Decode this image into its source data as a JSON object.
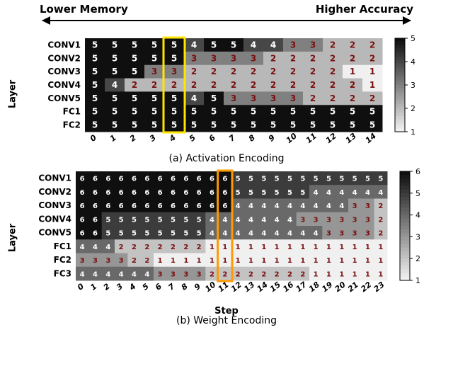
{
  "top_labels": {
    "left": "Lower Memory",
    "right": "Higher Accuracy"
  },
  "ylabel": "Layer",
  "xlabel": "Step",
  "caption_a": "(a) Activation Encoding",
  "caption_b": "(b) Weight Encoding",
  "chart_data": [
    {
      "id": "a",
      "type": "heatmap",
      "title": "Activation Encoding",
      "x": [
        0,
        1,
        2,
        3,
        4,
        5,
        6,
        7,
        8,
        9,
        10,
        11,
        12,
        13,
        14
      ],
      "y": [
        "CONV1",
        "CONV2",
        "CONV3",
        "CONV4",
        "CONV5",
        "FC1",
        "FC2"
      ],
      "values": [
        [
          5,
          5,
          5,
          5,
          5,
          4,
          5,
          5,
          4,
          4,
          3,
          3,
          2,
          2,
          2
        ],
        [
          5,
          5,
          5,
          5,
          5,
          3,
          3,
          3,
          3,
          2,
          2,
          2,
          2,
          2,
          2
        ],
        [
          5,
          5,
          5,
          3,
          3,
          2,
          2,
          2,
          2,
          2,
          2,
          2,
          2,
          1,
          1
        ],
        [
          5,
          4,
          2,
          2,
          2,
          2,
          2,
          2,
          2,
          2,
          2,
          2,
          2,
          2,
          1
        ],
        [
          5,
          5,
          5,
          5,
          5,
          4,
          5,
          3,
          3,
          3,
          3,
          2,
          2,
          2,
          2
        ],
        [
          5,
          5,
          5,
          5,
          5,
          5,
          5,
          5,
          5,
          5,
          5,
          5,
          5,
          5,
          5
        ],
        [
          5,
          5,
          5,
          5,
          5,
          5,
          5,
          5,
          5,
          5,
          5,
          5,
          5,
          5,
          5
        ]
      ],
      "value_range": [
        1,
        5
      ],
      "colorbar_ticks": [
        1,
        2,
        3,
        4,
        5
      ],
      "highlight_cols": [
        4,
        5
      ],
      "highlight_color": "#ffe600"
    },
    {
      "id": "b",
      "type": "heatmap",
      "title": "Weight Encoding",
      "x": [
        0,
        1,
        2,
        3,
        4,
        5,
        6,
        7,
        8,
        9,
        10,
        11,
        12,
        13,
        14,
        15,
        16,
        17,
        18,
        19,
        20,
        21,
        22,
        23
      ],
      "y": [
        "CONV1",
        "CONV2",
        "CONV3",
        "CONV4",
        "CONV5",
        "FC1",
        "FC2",
        "FC3"
      ],
      "values": [
        [
          6,
          6,
          6,
          6,
          6,
          6,
          6,
          6,
          6,
          6,
          6,
          6,
          5,
          5,
          5,
          5,
          5,
          5,
          5,
          5,
          5,
          5,
          5,
          5
        ],
        [
          6,
          6,
          6,
          6,
          6,
          6,
          6,
          6,
          6,
          6,
          6,
          6,
          5,
          5,
          5,
          5,
          5,
          5,
          4,
          4,
          4,
          4,
          4,
          4
        ],
        [
          6,
          6,
          6,
          6,
          6,
          6,
          6,
          6,
          6,
          6,
          6,
          6,
          4,
          4,
          4,
          4,
          4,
          4,
          4,
          4,
          4,
          3,
          3,
          2
        ],
        [
          6,
          6,
          5,
          5,
          5,
          5,
          5,
          5,
          5,
          5,
          4,
          4,
          4,
          4,
          4,
          4,
          4,
          3,
          3,
          3,
          3,
          3,
          3,
          2
        ],
        [
          6,
          6,
          5,
          5,
          5,
          5,
          5,
          5,
          5,
          5,
          4,
          4,
          4,
          4,
          4,
          4,
          4,
          4,
          4,
          3,
          3,
          3,
          3,
          2
        ],
        [
          4,
          4,
          4,
          2,
          2,
          2,
          2,
          2,
          2,
          2,
          1,
          1,
          1,
          1,
          1,
          1,
          1,
          1,
          1,
          1,
          1,
          1,
          1,
          1
        ],
        [
          3,
          3,
          3,
          3,
          2,
          2,
          1,
          1,
          1,
          1,
          1,
          1,
          1,
          1,
          1,
          1,
          1,
          1,
          1,
          1,
          1,
          1,
          1,
          1
        ],
        [
          4,
          4,
          4,
          4,
          4,
          4,
          3,
          3,
          3,
          3,
          2,
          2,
          2,
          2,
          2,
          2,
          2,
          2,
          1,
          1,
          1,
          1,
          1,
          1
        ]
      ],
      "value_range": [
        1,
        6
      ],
      "colorbar_ticks": [
        1,
        2,
        3,
        4,
        5,
        6
      ],
      "highlight_cols": [
        11,
        12
      ],
      "highlight_color": "#ff9a00"
    }
  ]
}
